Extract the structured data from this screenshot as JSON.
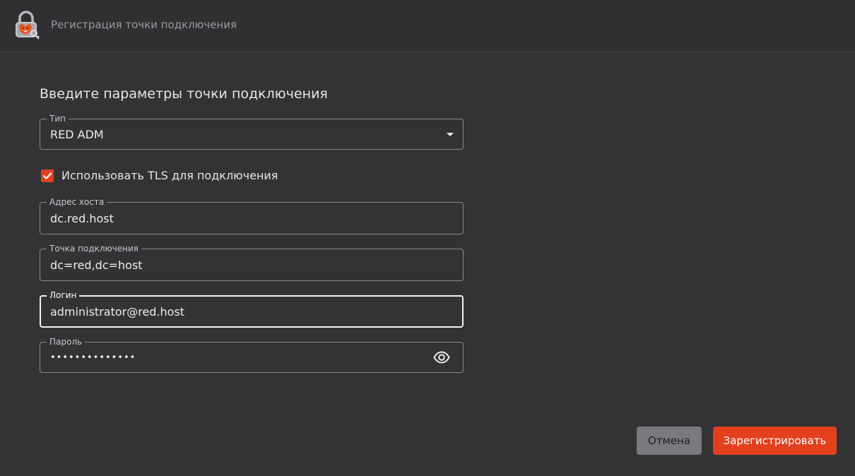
{
  "header": {
    "title": "Регистрация точки подключения",
    "logo_icon": "lock-fox-logo-icon"
  },
  "form": {
    "title": "Введите параметры точки подключения",
    "type": {
      "label": "Тип",
      "value": "RED ADM",
      "icon": "caret-down-icon"
    },
    "tls": {
      "label": "Использовать TLS для подключения",
      "checked": true
    },
    "host": {
      "label": "Адрес хоста",
      "value": "dc.red.host"
    },
    "endpoint": {
      "label": "Точка подключения",
      "value": "dc=red,dc=host"
    },
    "login": {
      "label": "Логин",
      "value": "administrator@red.host"
    },
    "password": {
      "label": "Пароль",
      "value": "••••••••••••••",
      "icon": "eye-icon"
    }
  },
  "actions": {
    "cancel_label": "Отмена",
    "register_label": "Зарегистрировать"
  },
  "colors": {
    "accent": "#e4401e",
    "background": "#333336",
    "cancel_button": "#7a7a7e"
  }
}
